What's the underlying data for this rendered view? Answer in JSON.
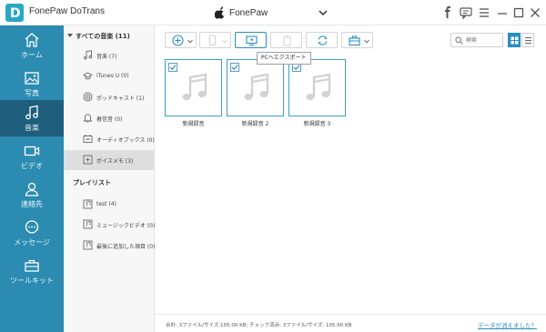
{
  "app": {
    "title": "FonePaw DoTrans",
    "logo_letter": "D"
  },
  "device": {
    "name": "FonePaw"
  },
  "window_controls": [
    "facebook-icon",
    "chat-icon",
    "menu-icon",
    "minimize-icon",
    "maximize-icon",
    "close-icon"
  ],
  "sidebar": {
    "items": [
      {
        "label": "ホーム",
        "icon": "home-icon"
      },
      {
        "label": "写真",
        "icon": "photo-icon"
      },
      {
        "label": "音楽",
        "icon": "music-icon",
        "active": true
      },
      {
        "label": "ビデオ",
        "icon": "video-icon"
      },
      {
        "label": "連絡先",
        "icon": "contacts-icon"
      },
      {
        "label": "メッセージ",
        "icon": "message-icon"
      },
      {
        "label": "ツールキット",
        "icon": "toolkit-icon"
      }
    ]
  },
  "categories": {
    "header": "すべての音楽 (11)",
    "items": [
      {
        "label": "音楽 (7)",
        "icon": "music-note-icon"
      },
      {
        "label": "iTunes U (0)",
        "icon": "itunes-u-icon"
      },
      {
        "label": "ポッドキャスト (1)",
        "icon": "podcast-icon"
      },
      {
        "label": "着信音 (0)",
        "icon": "ringtone-icon"
      },
      {
        "label": "オーディオブックス (0)",
        "icon": "audiobook-icon"
      },
      {
        "label": "ボイスメモ (3)",
        "icon": "voice-memo-icon",
        "active": true
      }
    ],
    "playlist_header": "プレイリスト",
    "playlists": [
      {
        "label": "test (4)",
        "icon": "playlist-icon"
      },
      {
        "label": "ミュージックビデオ (0)",
        "icon": "playlist-icon"
      },
      {
        "label": "最後に追加した項目 (0)",
        "icon": "playlist-icon"
      }
    ]
  },
  "toolbar": {
    "tooltip": "PCへエクスポート",
    "search_placeholder": "検索"
  },
  "files": [
    {
      "name": "新規録音",
      "checked": true
    },
    {
      "name": "新規録音 2",
      "checked": true
    },
    {
      "name": "新規録音 3",
      "checked": true
    }
  ],
  "footer": {
    "summary": "合計: 3ファイル/サイズ:105.00 KB; チェック済み: 3ファイル/サイズ: 105.00 KB",
    "lost_link": "データが消えました？"
  },
  "colors": {
    "sidebar": "#2c8bb0",
    "sidebar_active": "#1f5f7d",
    "accent": "#2a8fc0"
  }
}
